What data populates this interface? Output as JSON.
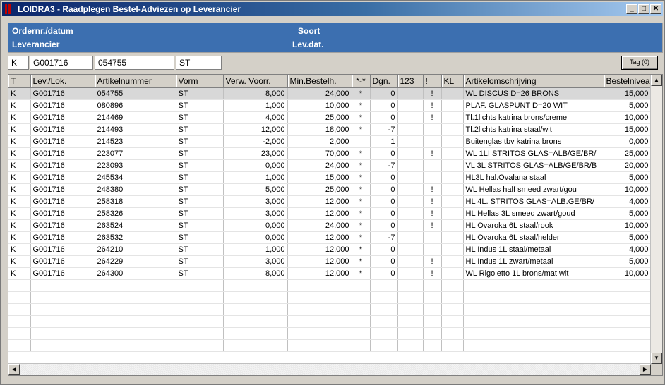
{
  "window": {
    "title": "LOIDRA3 - Raadplegen Bestel-Adviezen op Leverancier"
  },
  "header": {
    "ordernr_label": "Ordernr./datum",
    "soort_label": "Soort",
    "leverancier_label": "Leverancier",
    "levdat_label": "Lev.dat."
  },
  "filters": {
    "type": "K",
    "supplier": "G001716",
    "article": "054755",
    "form": "ST"
  },
  "tag_button": "Tag (0)",
  "columns": [
    "T",
    "Lev./Lok.",
    "Artikelnummer",
    "Vorm",
    "Verw. Voorr.",
    "Min.Bestelh.",
    "*-*",
    "Dgn.",
    "123",
    "!",
    "KL",
    "Artikelomschrijving",
    "Bestelniveau"
  ],
  "rows": [
    [
      "K",
      "G001716",
      "054755",
      "ST",
      "8,000",
      "24,000",
      "*",
      "0",
      "",
      "!",
      "",
      "WL DISCUS D=26       BRONS",
      "15,000"
    ],
    [
      "K",
      "G001716",
      "080896",
      "ST",
      "1,000",
      "10,000",
      "*",
      "0",
      "",
      "!",
      "",
      "PLAF. GLASPUNT D=20     WIT",
      "5,000"
    ],
    [
      "K",
      "G001716",
      "214469",
      "ST",
      "4,000",
      "25,000",
      "*",
      "0",
      "",
      "!",
      "",
      "Tl.1lichts katrina brons/creme",
      "10,000"
    ],
    [
      "K",
      "G001716",
      "214493",
      "ST",
      "12,000",
      "18,000",
      "*",
      "-7",
      "",
      "",
      "",
      "Tl.2lichts katrina staal/wit",
      "15,000"
    ],
    [
      "K",
      "G001716",
      "214523",
      "ST",
      "-2,000",
      "2,000",
      "",
      "1",
      "",
      "",
      "",
      "Buitenglas tbv katrina brons",
      "0,000"
    ],
    [
      "K",
      "G001716",
      "223077",
      "ST",
      "23,000",
      "70,000",
      "*",
      "0",
      "",
      "!",
      "",
      "WL 1LI STRITOS GLAS=ALB/GE/BR/",
      "25,000"
    ],
    [
      "K",
      "G001716",
      "223093",
      "ST",
      "0,000",
      "24,000",
      "*",
      "-7",
      "",
      "",
      "",
      "VL 3L STRITOS GLAS=ALB/GE/BR/B",
      "20,000"
    ],
    [
      "K",
      "G001716",
      "245534",
      "ST",
      "1,000",
      "15,000",
      "*",
      "0",
      "",
      "",
      "",
      "HL3L hal.Ovalana staal",
      "5,000"
    ],
    [
      "K",
      "G001716",
      "248380",
      "ST",
      "5,000",
      "25,000",
      "*",
      "0",
      "",
      "!",
      "",
      "WL Hellas half smeed zwart/gou",
      "10,000"
    ],
    [
      "K",
      "G001716",
      "258318",
      "ST",
      "3,000",
      "12,000",
      "*",
      "0",
      "",
      "!",
      "",
      "HL 4L. STRITOS GLAS=ALB.GE/BR/",
      "4,000"
    ],
    [
      "K",
      "G001716",
      "258326",
      "ST",
      "3,000",
      "12,000",
      "*",
      "0",
      "",
      "!",
      "",
      "HL Hellas 3L smeed zwart/goud",
      "5,000"
    ],
    [
      "K",
      "G001716",
      "263524",
      "ST",
      "0,000",
      "24,000",
      "*",
      "0",
      "",
      "!",
      "",
      "HL Ovaroka 6L staal/rook",
      "10,000"
    ],
    [
      "K",
      "G001716",
      "263532",
      "ST",
      "0,000",
      "12,000",
      "*",
      "-7",
      "",
      "",
      "",
      "HL Ovaroka 6L staal/helder",
      "5,000"
    ],
    [
      "K",
      "G001716",
      "264210",
      "ST",
      "1,000",
      "12,000",
      "*",
      "0",
      "",
      "",
      "",
      "HL Indus 1L staal/metaal",
      "4,000"
    ],
    [
      "K",
      "G001716",
      "264229",
      "ST",
      "3,000",
      "12,000",
      "*",
      "0",
      "",
      "!",
      "",
      "HL Indus 1L zwart/metaal",
      "5,000"
    ],
    [
      "K",
      "G001716",
      "264300",
      "ST",
      "8,000",
      "12,000",
      "*",
      "0",
      "",
      "!",
      "",
      "WL Rigoletto 1L brons/mat wit",
      "10,000"
    ]
  ],
  "empty_rows": 6,
  "colors": {
    "header_panel": "#3c6fb0",
    "title_start": "#0a246a",
    "title_end": "#a6caf0"
  }
}
